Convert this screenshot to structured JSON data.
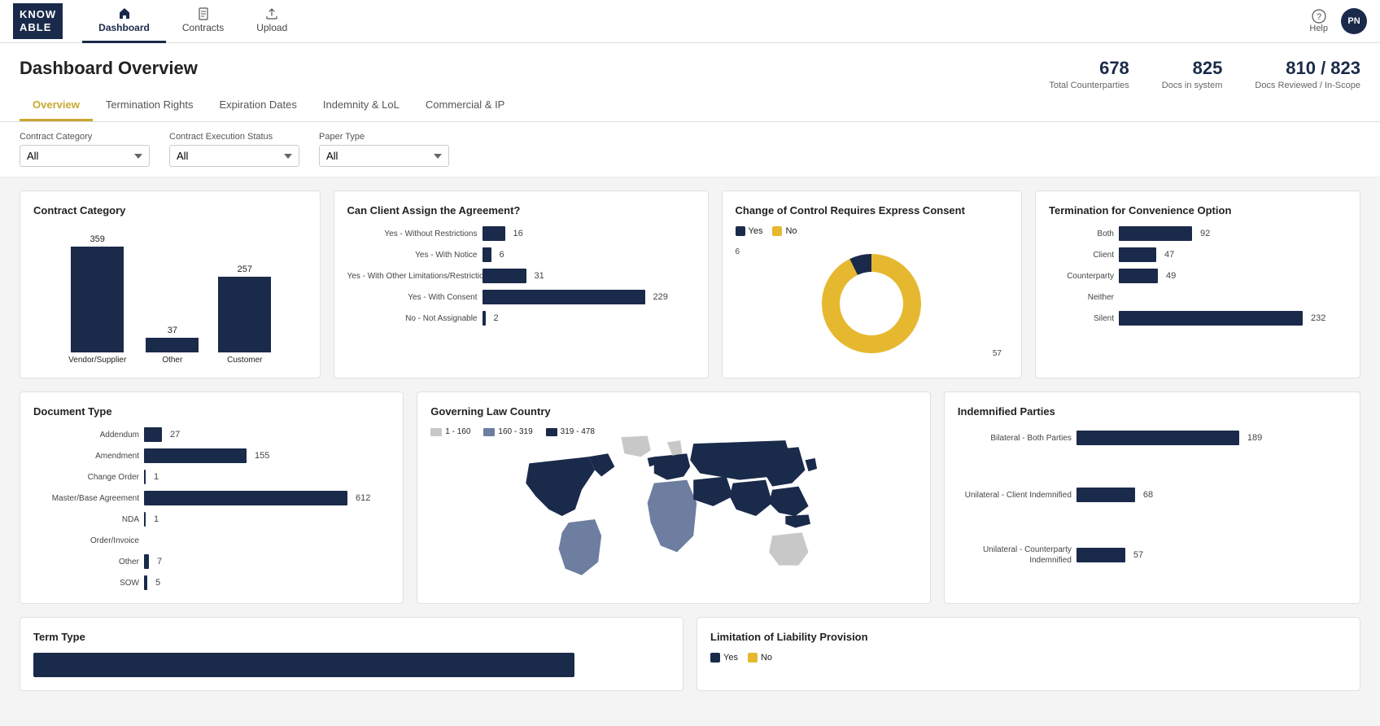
{
  "app": {
    "logo_line1": "KNOW",
    "logo_line2": "ABLE"
  },
  "nav": {
    "items": [
      {
        "label": "Dashboard",
        "icon": "home",
        "active": true
      },
      {
        "label": "Contracts",
        "icon": "doc",
        "active": false
      },
      {
        "label": "Upload",
        "icon": "upload",
        "active": false
      }
    ],
    "help_label": "Help",
    "avatar_initials": "PN"
  },
  "header": {
    "title": "Dashboard Overview",
    "stats": [
      {
        "num": "678",
        "label": "Total Counterparties"
      },
      {
        "num": "825",
        "label": "Docs in system"
      },
      {
        "num": "810 / 823",
        "label": "Docs Reviewed / In-Scope"
      }
    ],
    "tabs": [
      {
        "label": "Overview",
        "active": true
      },
      {
        "label": "Termination Rights",
        "active": false
      },
      {
        "label": "Expiration Dates",
        "active": false
      },
      {
        "label": "Indemnity & LoL",
        "active": false
      },
      {
        "label": "Commercial & IP",
        "active": false
      }
    ]
  },
  "filters": {
    "contract_category": {
      "label": "Contract Category",
      "value": "All",
      "options": [
        "All"
      ]
    },
    "execution_status": {
      "label": "Contract Execution Status",
      "value": "All",
      "options": [
        "All"
      ]
    },
    "paper_type": {
      "label": "Paper Type",
      "value": "All",
      "options": [
        "All"
      ]
    }
  },
  "charts": {
    "contract_category": {
      "title": "Contract Category",
      "bars": [
        {
          "label": "Vendor/Supplier",
          "value": 359,
          "height_pct": 100
        },
        {
          "label": "Other",
          "value": 37,
          "height_pct": 10
        },
        {
          "label": "Customer",
          "value": 257,
          "height_pct": 72
        }
      ]
    },
    "can_client_assign": {
      "title": "Can Client Assign the Agreement?",
      "bars": [
        {
          "label": "Yes - Without Restrictions",
          "value": 16,
          "width_pct": 7
        },
        {
          "label": "Yes - With Notice",
          "value": 6,
          "width_pct": 3
        },
        {
          "label": "Yes - With Other Limitations/Restrictions...",
          "value": 31,
          "width_pct": 14
        },
        {
          "label": "Yes - With Consent",
          "value": 229,
          "width_pct": 100
        },
        {
          "label": "No - Not Assignable",
          "value": 2,
          "width_pct": 1
        }
      ]
    },
    "change_of_control": {
      "title": "Change of Control Requires Express Consent",
      "yes_value": 6,
      "no_value": 57,
      "yes_color": "#1a2a4a",
      "no_color": "#e6b830",
      "legend_yes": "Yes",
      "legend_no": "No"
    },
    "termination_for_convenience": {
      "title": "Termination for Convenience Option",
      "bars": [
        {
          "label": "Both",
          "value": 92,
          "width_pct": 40
        },
        {
          "label": "Client",
          "value": 47,
          "width_pct": 20
        },
        {
          "label": "Counterparty",
          "value": 49,
          "width_pct": 21
        },
        {
          "label": "Neither",
          "value": 0,
          "width_pct": 0
        },
        {
          "label": "Silent",
          "value": 232,
          "width_pct": 100
        }
      ]
    },
    "document_type": {
      "title": "Document Type",
      "bars": [
        {
          "label": "Addendum",
          "value": 27,
          "width_pct": 4
        },
        {
          "label": "Amendment",
          "value": 155,
          "width_pct": 25
        },
        {
          "label": "Change Order",
          "value": 1,
          "width_pct": 0.2
        },
        {
          "label": "Master/Base Agreement",
          "value": 612,
          "width_pct": 100
        },
        {
          "label": "NDA",
          "value": 1,
          "width_pct": 0.2
        },
        {
          "label": "Order/Invoice",
          "value": 0,
          "width_pct": 0
        },
        {
          "label": "Other",
          "value": 7,
          "width_pct": 1
        },
        {
          "label": "SOW",
          "value": 5,
          "width_pct": 0.8
        }
      ]
    },
    "governing_law": {
      "title": "Governing Law Country",
      "legend": [
        {
          "label": "1 - 160",
          "color": "#c8c8c8"
        },
        {
          "label": "160 - 319",
          "color": "#6e7ea0"
        },
        {
          "label": "319 - 478",
          "color": "#1a2a4a"
        }
      ]
    },
    "indemnified_parties": {
      "title": "Indemnified Parties",
      "bars": [
        {
          "label": "Bilateral - Both Parties",
          "value": 189,
          "width_pct": 100
        },
        {
          "label": "Unilateral - Client Indemnified",
          "value": 68,
          "width_pct": 36
        },
        {
          "label": "Unilateral - Counterparty Indemnified",
          "value": 57,
          "width_pct": 30
        }
      ]
    },
    "term_type": {
      "title": "Term Type"
    },
    "limitation_of_liability": {
      "title": "Limitation of Liability Provision"
    }
  }
}
